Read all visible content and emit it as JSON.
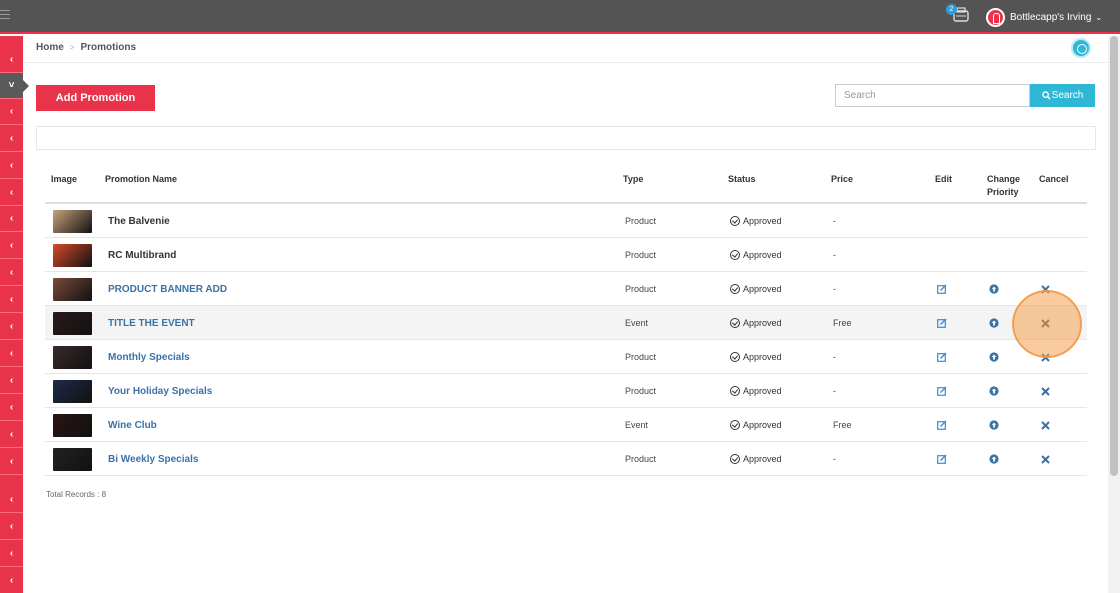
{
  "topbar": {
    "notification_count": "2",
    "user_name": "Bottlecapp's Irving"
  },
  "breadcrumb": {
    "home": "Home",
    "current": "Promotions"
  },
  "toolbar": {
    "add_label": "Add Promotion",
    "search_placeholder": "Search",
    "search_label": "Search"
  },
  "table": {
    "headers": {
      "image": "Image",
      "name": "Promotion Name",
      "type": "Type",
      "status": "Status",
      "price": "Price",
      "edit": "Edit",
      "priority": "Change Priority",
      "cancel": "Cancel"
    },
    "rows": [
      {
        "name": "The Balvenie",
        "type": "Product",
        "status": "Approved",
        "price": "-",
        "editable": false,
        "thumb_color": "#c9a27a"
      },
      {
        "name": "RC Multibrand",
        "type": "Product",
        "status": "Approved",
        "price": "-",
        "editable": false,
        "thumb_color": "#d94a2a"
      },
      {
        "name": "PRODUCT BANNER ADD",
        "type": "Product",
        "status": "Approved",
        "price": "-",
        "editable": true,
        "thumb_color": "#7a4a3a"
      },
      {
        "name": "TITLE THE EVENT",
        "type": "Event",
        "status": "Approved",
        "price": "Free",
        "editable": true,
        "thumb_color": "#2a1a1a"
      },
      {
        "name": "Monthly Specials",
        "type": "Product",
        "status": "Approved",
        "price": "-",
        "editable": true,
        "thumb_color": "#3a2a2a"
      },
      {
        "name": "Your Holiday Specials",
        "type": "Product",
        "status": "Approved",
        "price": "-",
        "editable": true,
        "thumb_color": "#1e2a4a"
      },
      {
        "name": "Wine Club",
        "type": "Event",
        "status": "Approved",
        "price": "Free",
        "editable": true,
        "thumb_color": "#2a1414"
      },
      {
        "name": "Bi Weekly Specials",
        "type": "Product",
        "status": "Approved",
        "price": "-",
        "editable": true,
        "thumb_color": "#222222"
      }
    ]
  },
  "footer": {
    "total_records": "Total Records : 8"
  },
  "colors": {
    "brand": "#e8334a",
    "accent": "#2fb8d6",
    "link": "#3a72a8"
  }
}
